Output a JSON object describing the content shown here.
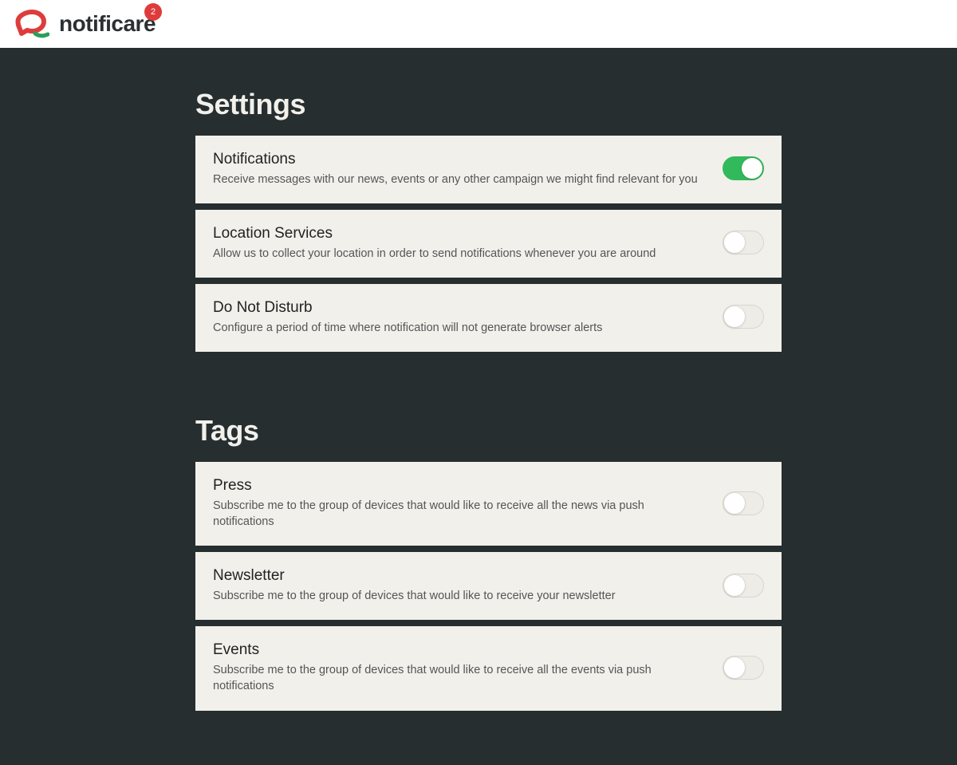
{
  "header": {
    "brand": "notificare",
    "badge_count": "2"
  },
  "sections": {
    "settings": {
      "title": "Settings",
      "items": [
        {
          "title": "Notifications",
          "desc": "Receive messages with our news, events or any other campaign we might find relevant for you",
          "on": true
        },
        {
          "title": "Location Services",
          "desc": "Allow us to collect your location in order to send notifications whenever you are around",
          "on": false
        },
        {
          "title": "Do Not Disturb",
          "desc": "Configure a period of time where notification will not generate browser alerts",
          "on": false
        }
      ]
    },
    "tags": {
      "title": "Tags",
      "items": [
        {
          "title": "Press",
          "desc": "Subscribe me to the group of devices that would like to receive all the news via push notifications",
          "on": false
        },
        {
          "title": "Newsletter",
          "desc": "Subscribe me to the group of devices that would like to receive your newsletter",
          "on": false
        },
        {
          "title": "Events",
          "desc": "Subscribe me to the group of devices that would like to receive all the events via push notifications",
          "on": false
        }
      ]
    }
  }
}
